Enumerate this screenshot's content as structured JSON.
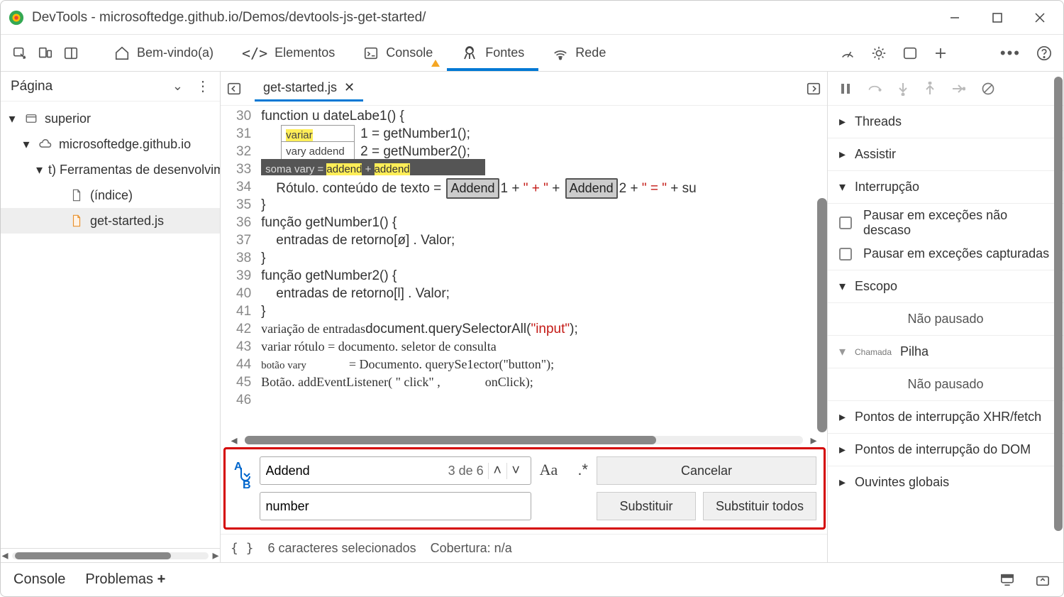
{
  "window": {
    "title": "DevTools - microsoftedge.github.io/Demos/devtools-js-get-started/"
  },
  "tabs": {
    "welcome": "Bem-vindo(a)",
    "elements": "Elementos",
    "console": "Console",
    "sources": "Fontes",
    "network": "Rede"
  },
  "leftPanel": {
    "header": "Página",
    "tree": {
      "root": "superior",
      "domain": "microsoftedge.github.io",
      "folder": "t) Ferramentas de desenvolvimento",
      "index": "(índice)",
      "file": "get-started.js"
    }
  },
  "editor": {
    "tab": "get-started.js",
    "gutter": [
      "30",
      "31",
      "32",
      "33",
      "34",
      "35",
      "36",
      "37",
      "38",
      "39",
      "40",
      "41",
      "42",
      "43",
      "44",
      "45",
      "46"
    ],
    "lines": {
      "l30": "function u dateLabe1() {",
      "l31a": "1 = getNumber1();",
      "l32a": "2 = getNumber2();",
      "l33suffix": ";",
      "l34_pre": "Rótulo. conteúdo de texto = ",
      "l34_one": "1 + ",
      "l34_plus1": "\" + \"",
      "l34_plus2": " + ",
      "l34_two": "2 + ",
      "l34_eq": "\" = \"",
      "l34_end": " + su",
      "l35": "}",
      "l36": "função getNumber1() {",
      "l37": "    entradas de retorno[ø] . Valor;",
      "l38": "}",
      "l39": "função getNumber2() {",
      "l40": "    entradas de retorno[l] . Valor;",
      "l41": "}",
      "l42a": "variação de entradas",
      "l42b": "document.querySelectorAll(",
      "l42c": "\"input\"",
      "l42d": ");",
      "l43": "variar rótulo = documento. seletor de consulta",
      "l44a": "botão vary",
      "l44b": "= Documento. querySe1ector(\"button\");",
      "l45": "Botão. addEventListener( \" click\" ,              onClick);"
    },
    "hints": {
      "h31": "variar addend",
      "h32": "vary addend",
      "h33": "soma vary = addend + addend"
    },
    "addendBox": "Addend"
  },
  "findReplace": {
    "searchValue": "Addend",
    "resultCount": "3 de 6",
    "replaceValue": "number",
    "matchCase": "Aa",
    "regex": ".*",
    "cancel": "Cancelar",
    "replace": "Substituir",
    "replaceAll": "Substituir todos"
  },
  "editorStatus": {
    "braces": "{ }",
    "selection": "6 caracteres selecionados",
    "coverage": "Cobertura: n/a"
  },
  "debugger": {
    "threads": "Threads",
    "watch": "Assistir",
    "pause": "Interrupção",
    "pauseUncaught": "Pausar em exceções não descaso",
    "pauseCaught": "Pausar em exceções capturadas",
    "scope": "Escopo",
    "notPaused": "Não pausado",
    "callstackSmall": "Chamada",
    "callstack": "Pilha",
    "xhr": "Pontos de interrupção XHR/fetch",
    "dom": "Pontos de interrupção do DOM",
    "listeners": "Ouvintes globais"
  },
  "drawer": {
    "console": "Console",
    "problems": "Problemas"
  }
}
